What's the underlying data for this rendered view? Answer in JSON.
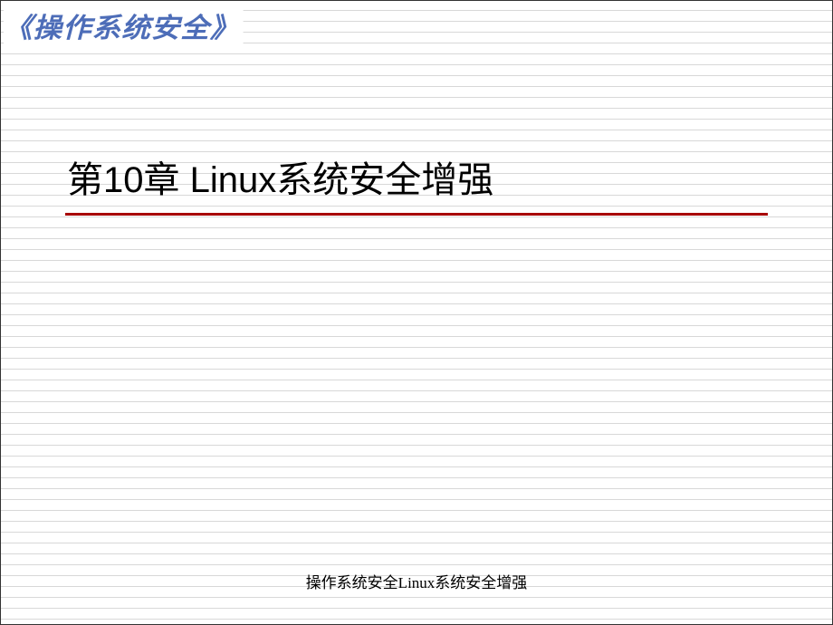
{
  "header": {
    "title": "《操作系统安全》"
  },
  "main": {
    "chapter_title": "第10章 Linux系统安全增强"
  },
  "footer": {
    "text": "操作系统安全Linux系统安全增强"
  }
}
